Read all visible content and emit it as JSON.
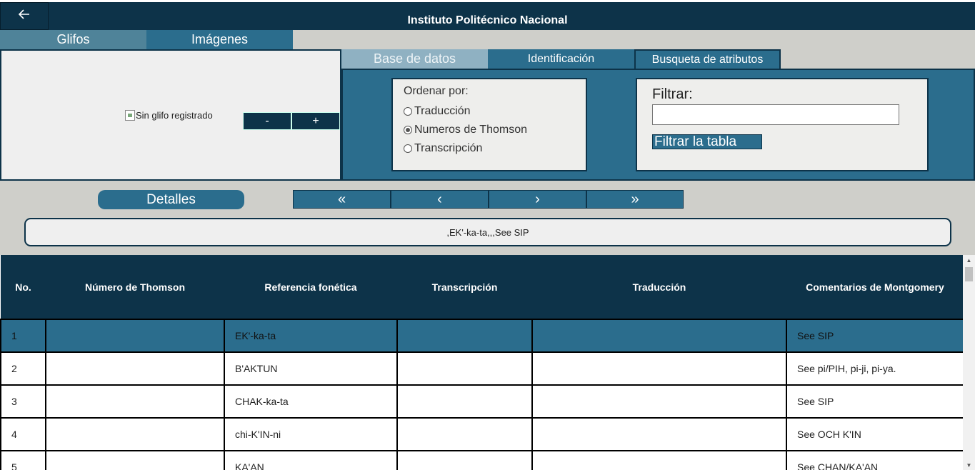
{
  "header": {
    "back_icon": "arrow-left-icon",
    "back_glyph": "🡐",
    "title": "Instituto Politécnico Nacional"
  },
  "left_tabs": [
    "Glifos",
    "Imágenes"
  ],
  "glyph": {
    "alt_text": "Sin glifo registrado",
    "zoom_out": "-",
    "zoom_in": "+"
  },
  "right_tabs": [
    "Base de datos",
    "Identificación",
    "Busqueta de atributos"
  ],
  "order": {
    "title": "Ordenar por:",
    "options": [
      "Traducción",
      "Numeros de Thomson",
      "Transcripción"
    ],
    "selected": "Numeros de Thomson"
  },
  "filter": {
    "label": "Filtrar:",
    "value": "",
    "button": "Filtrar la tabla"
  },
  "details_button": "Detalles",
  "pager": {
    "first": "«",
    "prev": "‹",
    "next": "›",
    "last": "»"
  },
  "record_line": ",EK'-ka-ta,,,See SIP",
  "table": {
    "headers": [
      "No.",
      "Número de Thomson",
      "Referencia fonética",
      "Transcripción",
      "Traducción",
      "Comentarios de Montgomery"
    ],
    "rows": [
      [
        "1",
        "",
        "EK'-ka-ta",
        "",
        "",
        "See SIP"
      ],
      [
        "2",
        "",
        "B'AKTUN",
        "",
        "",
        "See pi/PIH, pi-ji, pi-ya."
      ],
      [
        "3",
        "",
        "CHAK-ka-ta",
        "",
        "",
        "See SIP"
      ],
      [
        "4",
        "",
        "chi-K'IN-ni",
        "",
        "",
        "See OCH K'IN"
      ],
      [
        "5",
        "",
        "KA'AN",
        "",
        "",
        "See CHAN/KA'AN"
      ]
    ],
    "selected_row": 1
  },
  "colors": {
    "navy": "#0d3349",
    "teal": "#2b6d8d",
    "light_teal": "#8fb1c2",
    "background": "#cfcfca"
  }
}
